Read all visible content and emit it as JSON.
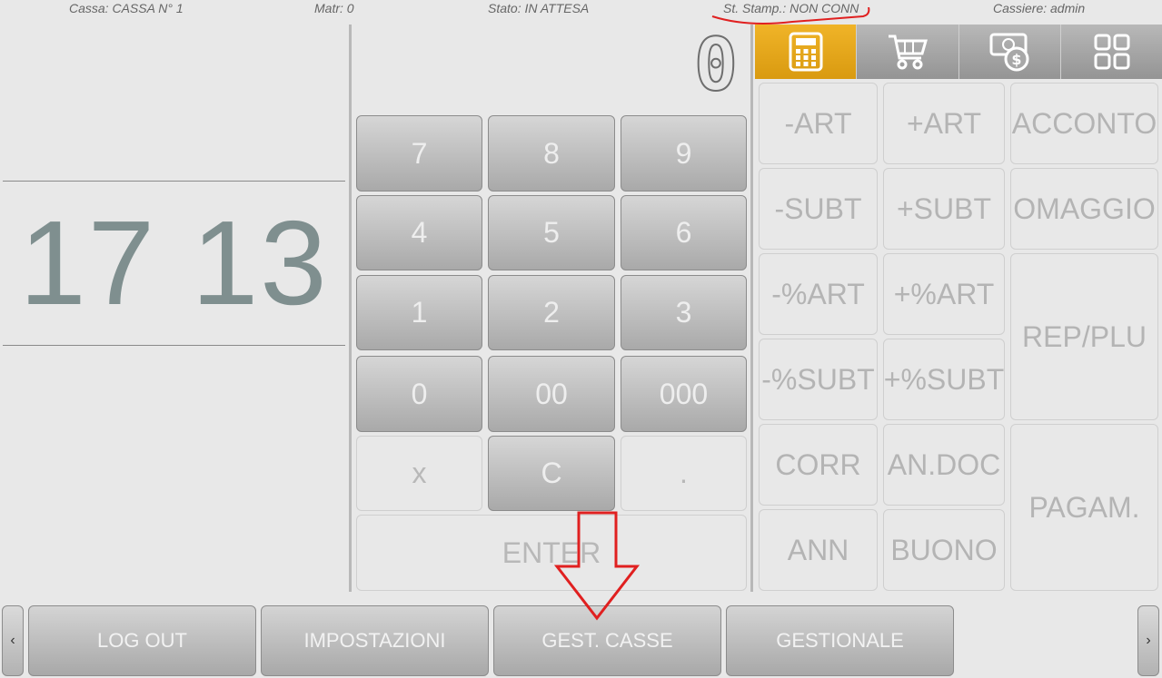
{
  "status_bar": {
    "cassa": "Cassa: CASSA N° 1",
    "matr": "Matr: 0",
    "stato": "Stato: IN ATTESA",
    "printer": "St. Stamp.: NON CONN",
    "cassiere": "Cassiere: admin"
  },
  "clock": "17 13",
  "display": {
    "value": "0"
  },
  "keypad": {
    "k7": "7",
    "k8": "8",
    "k9": "9",
    "k4": "4",
    "k5": "5",
    "k6": "6",
    "k1": "1",
    "k2": "2",
    "k3": "3",
    "k0": "0",
    "k00": "00",
    "k000": "000",
    "kx": "x",
    "kc": "C",
    "kdot": ".",
    "enter": "ENTER"
  },
  "tabs": [
    {
      "icon": "calculator-icon",
      "active": true
    },
    {
      "icon": "cart-icon",
      "active": false
    },
    {
      "icon": "cash-icon",
      "active": false
    },
    {
      "icon": "grid-icon",
      "active": false
    }
  ],
  "functions": {
    "minus_art": "-ART",
    "plus_art": "+ART",
    "acconto": "ACCONTO",
    "minus_subt": "-SUBT",
    "plus_subt": "+SUBT",
    "omaggio": "OMAGGIO",
    "minus_pct_art": "-%ART",
    "plus_pct_art": "+%ART",
    "rep_plu": "REP/PLU",
    "minus_pct_subt": "-%SUBT",
    "plus_pct_subt": "+%SUBT",
    "corr": "CORR",
    "an_doc": "AN.DOC",
    "pagam": "PAGAM.",
    "ann": "ANN",
    "buono": "BUONO"
  },
  "bottom_bar": {
    "prev": "‹",
    "logout": "LOG OUT",
    "impostazioni": "IMPOSTAZIONI",
    "gest_casse": "GEST. CASSE",
    "gestionale": "GESTIONALE",
    "next": "›"
  },
  "colors": {
    "accent": "#e6a716",
    "annotation": "#e02020",
    "clock": "#7f8f8f"
  }
}
